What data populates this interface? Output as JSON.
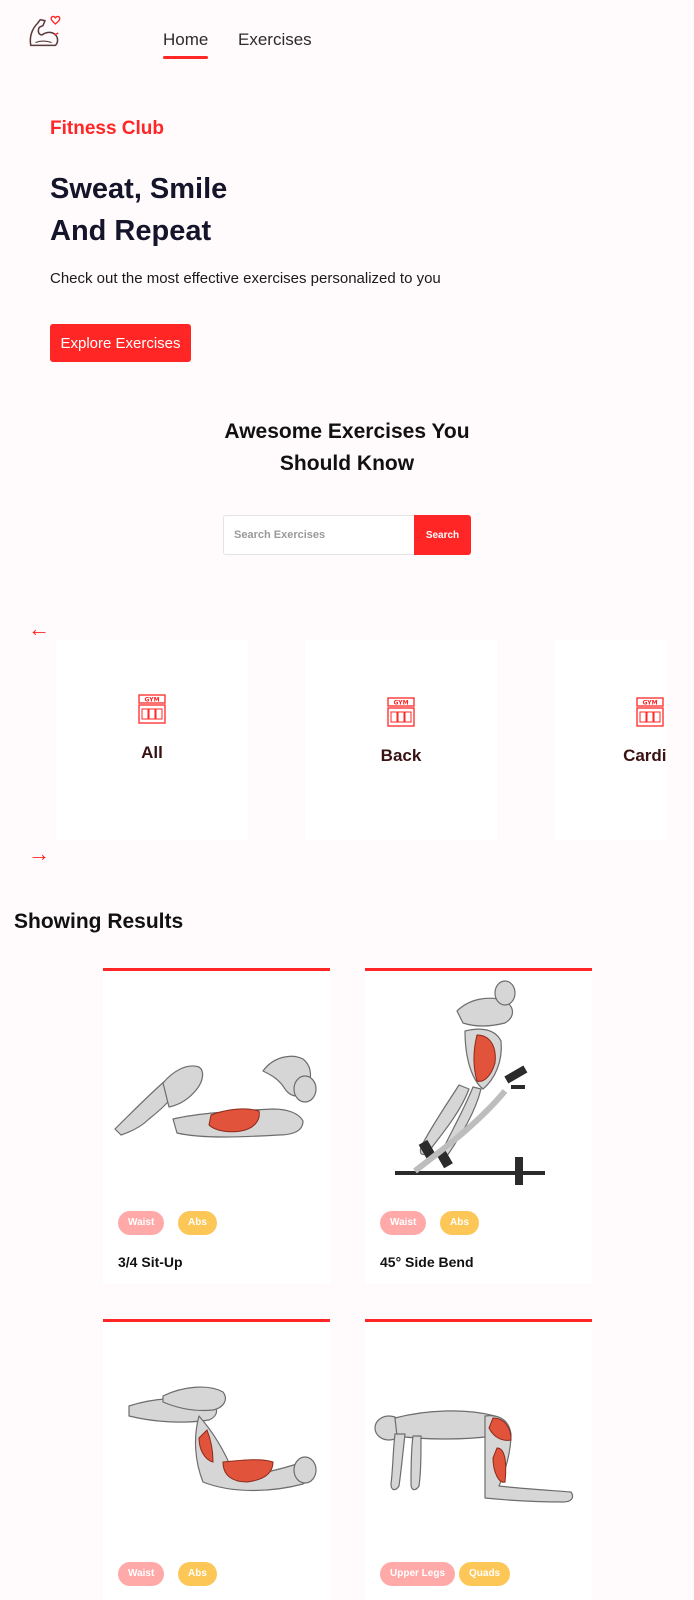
{
  "nav": {
    "logo": "flexed-arm-heart-logo",
    "links": [
      {
        "label": "Home",
        "active": true
      },
      {
        "label": "Exercises",
        "active": false
      }
    ]
  },
  "hero": {
    "tag": "Fitness Club",
    "title_line1": "Sweat, Smile",
    "title_line2": "And Repeat",
    "subtitle": "Check out the most effective exercises personalized to you",
    "button": "Explore Exercises"
  },
  "search": {
    "title_line1": "Awesome Exercises You",
    "title_line2": "Should Know",
    "placeholder": "Search Exercises",
    "button": "Search"
  },
  "categories": {
    "prev_icon": "arrow-left-icon",
    "next_icon": "arrow-right-icon",
    "items": [
      {
        "label": "All",
        "icon": "gym-icon",
        "active": true
      },
      {
        "label": "Back",
        "icon": "gym-icon",
        "active": false
      },
      {
        "label": "Cardio",
        "icon": "gym-icon",
        "active": false
      }
    ]
  },
  "results": {
    "title": "Showing Results",
    "items": [
      {
        "name": "3/4 Sit-Up",
        "tags": [
          "Waist",
          "Abs"
        ]
      },
      {
        "name": "45° Side Bend",
        "tags": [
          "Waist",
          "Abs"
        ]
      },
      {
        "name": "",
        "tags": [
          "Waist",
          "Abs"
        ]
      },
      {
        "name": "",
        "tags": [
          "Upper Legs",
          "Quads"
        ]
      }
    ]
  },
  "colors": {
    "accent": "#ff2625",
    "tag_primary": "#ffa9a9",
    "tag_secondary": "#fcc757",
    "background": "#fffafb"
  }
}
